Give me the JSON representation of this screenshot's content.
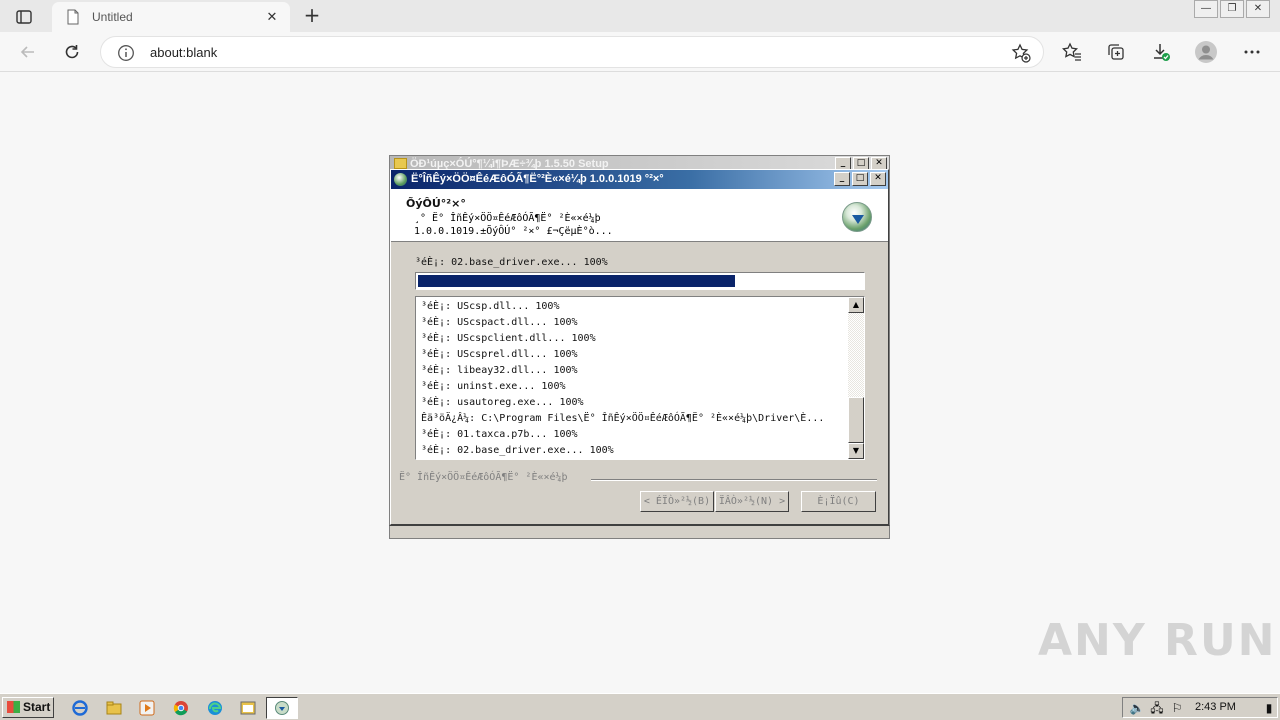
{
  "browser": {
    "tab_title": "Untitled",
    "url": "about:blank",
    "new_tab_glyph": "+",
    "close_glyph": "✕"
  },
  "icons": {
    "tab_actions": "tab-actions-icon",
    "back": "back-arrow-icon",
    "refresh": "refresh-icon",
    "info": "info-icon",
    "add_favorite": "star-plus-icon",
    "favorites": "favorites-icon",
    "collections": "collections-icon",
    "downloads": "download-icon",
    "profile": "profile-icon",
    "more": "more-icon"
  },
  "back_window": {
    "title": "ÖÐ¹úµç×ÓÚ°¶¼ì¶ÞÆ÷¾þ 1.5.50 Setup"
  },
  "installer": {
    "title": "Ë°ÎñÊý×ÖÖ¤ÊéÆôÓÃ¶Ë°²È«×é¼þ 1.0.0.1019 °²×°",
    "header_title": "ÕýÔÚ°²×°",
    "header_line1": "¸° Ë° ÎñÊý×ÖÖ¤ÊéÆôÓÃ¶Ë° ²È«×é¼þ",
    "header_line2": "1.0.0.1019.±ÕýÔÚ° ²×° £¬ÇëµÈ°ò...",
    "current_status": "³éÈ¡: 02.base_driver.exe... 100%",
    "progress": 0.715,
    "log_lines": [
      "³éÈ¡: UScsp.dll... 100%",
      "³éÈ¡: UScspact.dll... 100%",
      "³éÈ¡: UScspclient.dll... 100%",
      "³éÈ¡: UScsprel.dll... 100%",
      "³éÈ¡: libeay32.dll... 100%",
      "³éÈ¡: uninst.exe... 100%",
      "³éÈ¡: usautoreg.exe... 100%",
      "Êä³öÄ¿Â¼: C:\\Program Files\\Ë° ÎñÊý×ÖÖ¤ÊéÆôÓÃ¶Ë° ²È«×é¼þ\\Driver\\È...",
      "³éÈ¡: 01.taxca.p7b... 100%",
      "³éÈ¡: 02.base_driver.exe... 100%"
    ],
    "brand": "Ë° ÎñÊý×ÖÖ¤ÊéÆôÓÃ¶Ë° ²È«×é¼þ",
    "buttons": {
      "back": "< ÉÏÒ»²½(B)",
      "next": "ÏÂÒ»²½(N) >",
      "cancel": "È¡Ïû(C)"
    }
  },
  "watermark": "ANY RUN",
  "taskbar": {
    "start_label": "Start",
    "clock": "2:43 PM"
  }
}
